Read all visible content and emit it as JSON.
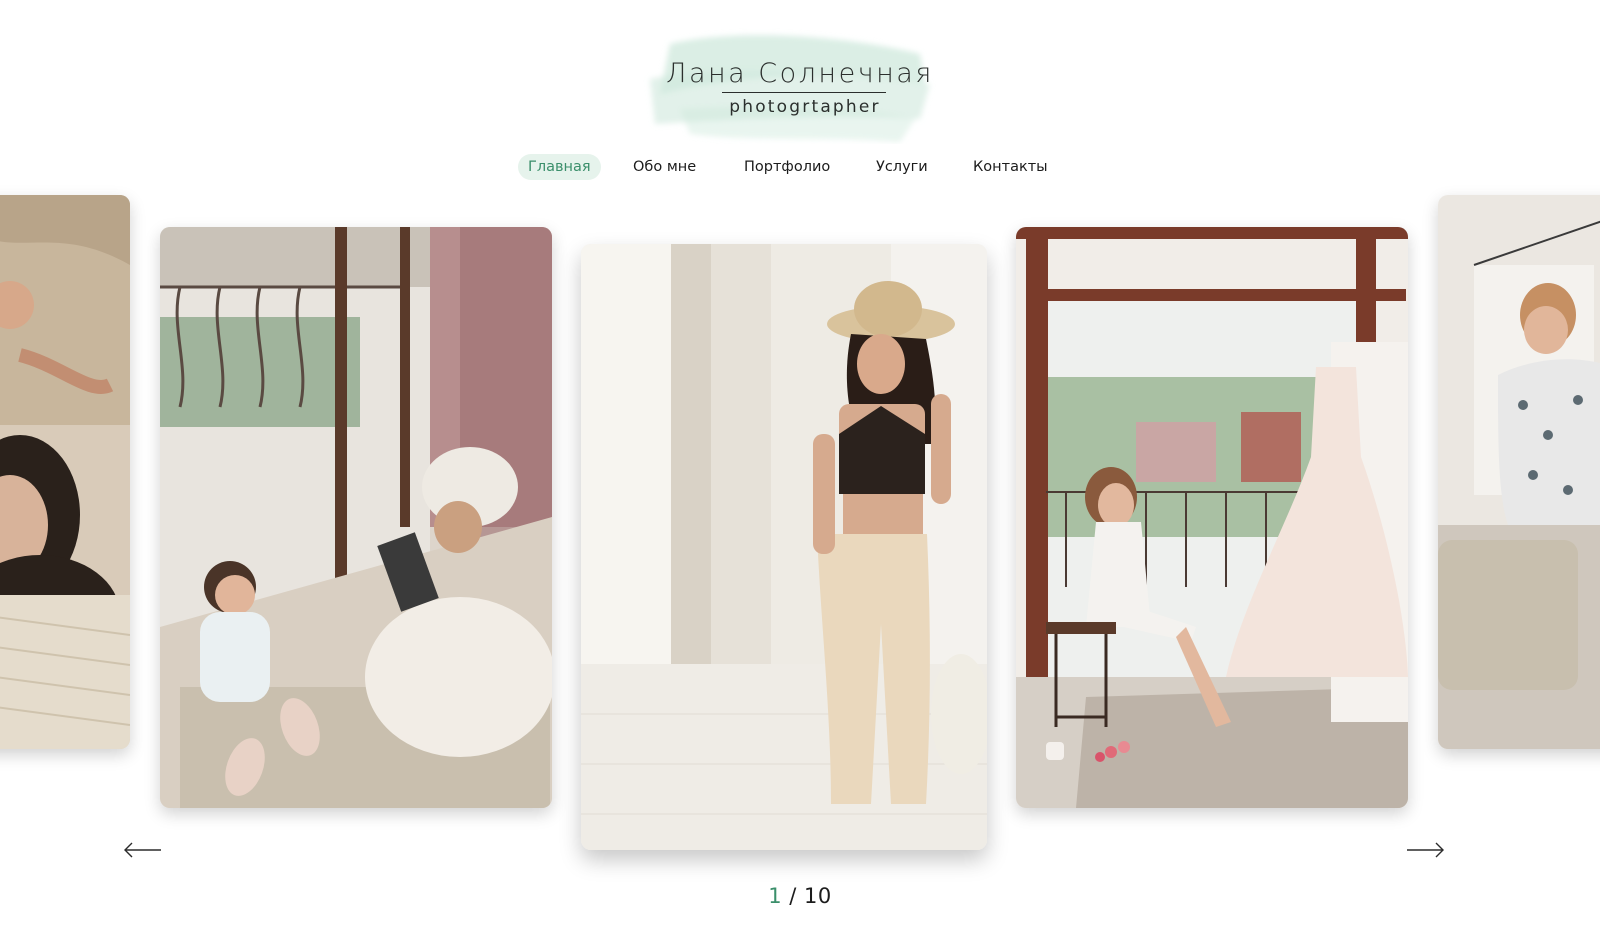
{
  "logo": {
    "name": "Лана Солнечная",
    "subtitle": "photogrtapher"
  },
  "nav": {
    "items": [
      {
        "label": "Главная",
        "active": true
      },
      {
        "label": "Обо мне",
        "active": false
      },
      {
        "label": "Портфолио",
        "active": false
      },
      {
        "label": "Услуги",
        "active": false
      },
      {
        "label": "Контакты",
        "active": false
      }
    ]
  },
  "carousel": {
    "slides": [
      {
        "subject": "woman-lying-on-fur-photo"
      },
      {
        "subject": "mother-and-baby-on-balcony-floor-photo"
      },
      {
        "subject": "woman-in-straw-hat-walking-photo"
      },
      {
        "subject": "bride-sitting-by-wedding-dress-photo"
      },
      {
        "subject": "woman-in-patterned-blouse-photo"
      }
    ],
    "prev_icon": "arrow-left-icon",
    "next_icon": "arrow-right-icon"
  },
  "counter": {
    "current": "1",
    "separator": "/",
    "total": "10"
  },
  "colors": {
    "accent": "#3b8f6b",
    "active_nav_bg": "#e6f3ec",
    "brush": "#cfe8dc"
  }
}
